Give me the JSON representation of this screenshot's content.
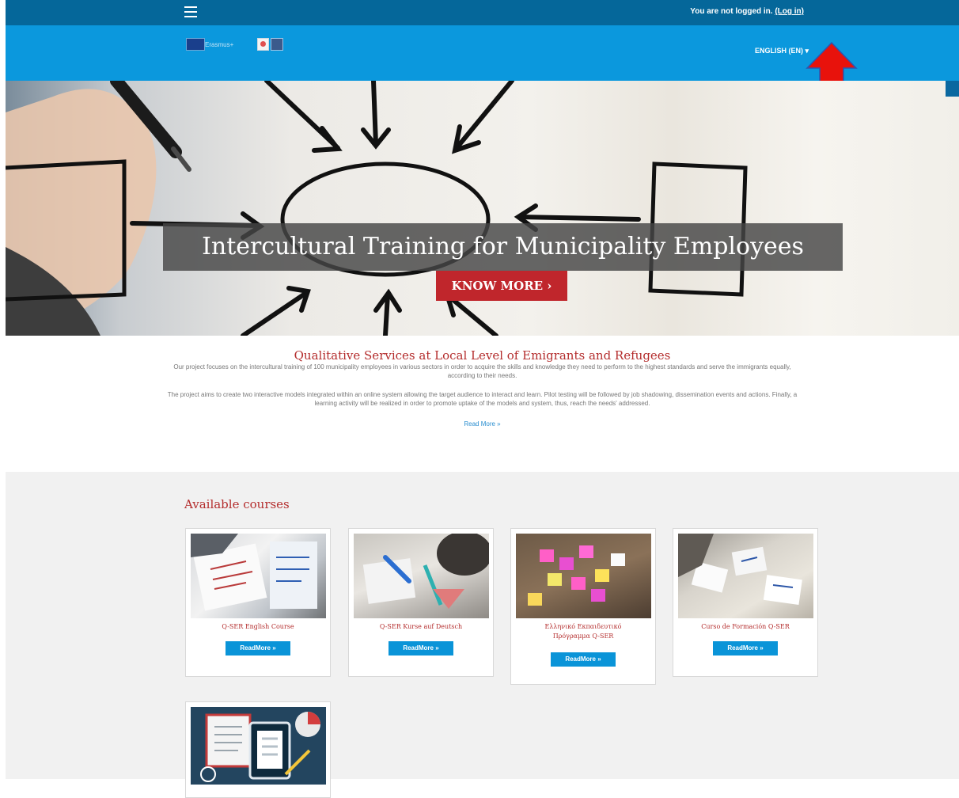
{
  "topbar": {
    "login_text": "You are not logged in.",
    "login_link": "(Log in)"
  },
  "header": {
    "logo_text": "Erasmus+",
    "language": "ENGLISH (EN)",
    "language_caret": "▾"
  },
  "hero": {
    "title": "Intercultural Training for Municipality Employees",
    "button": "KNOW MORE ›"
  },
  "about": {
    "heading": "Qualitative Services at Local Level of Emigrants and Refugees",
    "paragraph1": "Our project focuses on the intercultural training of 100 municipality employees in various sectors in order to acquire the skills and knowledge they need to perform to the highest standards and serve the immigrants equally, according to their needs.",
    "paragraph2": "The project aims to create two interactive models integrated within an online system allowing the target audience to interact and learn. Pilot testing will be followed by job shadowing, dissemination events and actions. Finally, a learning activity will be realized in order to promote uptake of the models and system, thus, reach the needs' addressed.",
    "read_more": "Read More »"
  },
  "courses": {
    "heading": "Available courses",
    "items": [
      {
        "title": "Q-SER English Course",
        "button": "ReadMore »"
      },
      {
        "title": "Q-SER Kurse auf Deutsch",
        "button": "ReadMore »"
      },
      {
        "title": "Ελληνικό Εκπαιδευτικό Πρόγραμμα Q-SER",
        "button": "ReadMore »"
      },
      {
        "title": "Curso de Formación Q-SER",
        "button": "ReadMore »"
      }
    ]
  },
  "colors": {
    "topbar": "#05679a",
    "header": "#0b98dd",
    "accent_red": "#c0262c",
    "button_blue": "#0a94d8"
  }
}
